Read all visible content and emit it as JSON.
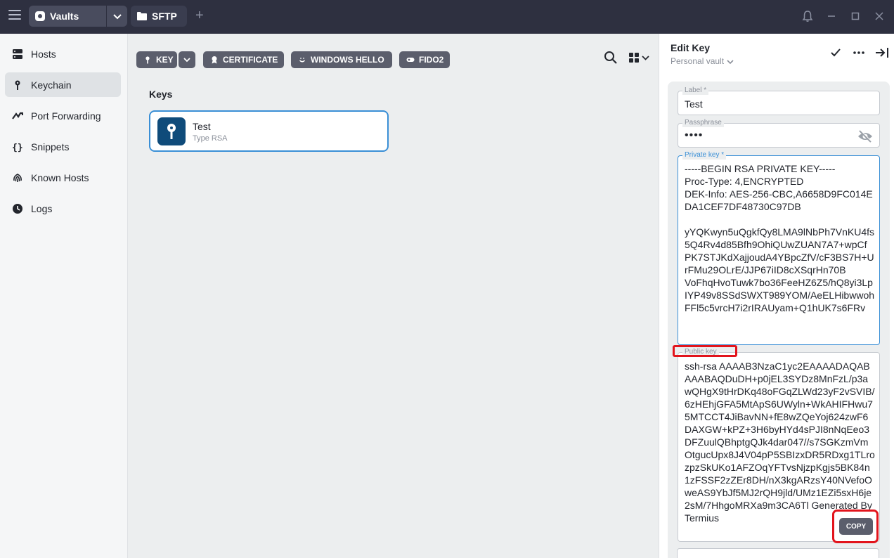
{
  "titlebar": {
    "tabs": [
      {
        "label": "Vaults",
        "icon": "vault-icon"
      },
      {
        "label": "SFTP",
        "icon": "folder-icon"
      }
    ]
  },
  "sidebar": {
    "items": [
      {
        "label": "Hosts",
        "icon": "hosts-icon",
        "active": false
      },
      {
        "label": "Keychain",
        "icon": "key-icon",
        "active": true
      },
      {
        "label": "Port Forwarding",
        "icon": "port-forwarding-icon",
        "active": false
      },
      {
        "label": "Snippets",
        "icon": "snippets-icon",
        "active": false
      },
      {
        "label": "Known Hosts",
        "icon": "fingerprint-icon",
        "active": false
      },
      {
        "label": "Logs",
        "icon": "clock-icon",
        "active": false
      }
    ]
  },
  "toolbar": {
    "key_label": "KEY",
    "certificate_label": "CERTIFICATE",
    "windows_hello_label": "WINDOWS HELLO",
    "fido2_label": "FIDO2"
  },
  "main": {
    "heading": "Keys",
    "keys": [
      {
        "name": "Test",
        "type": "Type RSA"
      }
    ]
  },
  "panel": {
    "title": "Edit Key",
    "vault": "Personal vault",
    "label_field": {
      "label": "Label *",
      "value": "Test"
    },
    "passphrase_field": {
      "label": "Passphrase",
      "value": "••••"
    },
    "private_key_field": {
      "label": "Private key *",
      "value": "-----BEGIN RSA PRIVATE KEY-----\nProc-Type: 4,ENCRYPTED\nDEK-Info: AES-256-CBC,A6658D9FC014EDA1CEF7DF48730C97DB\n\nyYQKwyn5uQgkfQy8LMA9lNbPh7VnKU4fs5Q4Rv4d85Bfh9OhiQUwZUAN7A7+wpCf\nPK7STJKdXajjoudA4YBpcZfV/cF3BS7H+UrFMu29OLrE/JJP67iID8cXSqrHn70B\nVoFhqHvoTuwk7bo36FeeHZ6Z5/hQ8yi3LpIYP49v8SSdSWXT989YOM/AeELHibwwohFFl5c5vrcH7i2rIRAUyam+Q1hUK7s6FRv"
    },
    "public_key_field": {
      "label": "Public key",
      "value": "ssh-rsa AAAAB3NzaC1yc2EAAAADAQABAAABAQDuDH+p0jEL3SYDz8MnFzL/p3awQHgX9tHrDKq48oFGqZLWd23yF2vSVIB/6zHEhjGFA5MtApS6UWyln+WkAHIFHwu75MTCCT4JiBavNN+fE8wZQeYoj624zwF6DAXGW+kPZ+3H6byHYd4sPJI8nNqEeo3DFZuulQBhptgQJk4dar047//s7SGKzmVmOtgucUpx8J4V04pP5SBIzxDR5RDxg1TLrozpzSkUKo1AFZOqYFTvsNjzpKgjs5BK84n1zFSSF2zZEr8DH/nX3kgARzsY40NVefoOweAS9YbJf5MJ2rQH9jld/UMz1EZi5sxH6je2sM/7HhgoMRXa9m3CA6Tl Generated By Termius"
    },
    "copy_label": "COPY"
  }
}
